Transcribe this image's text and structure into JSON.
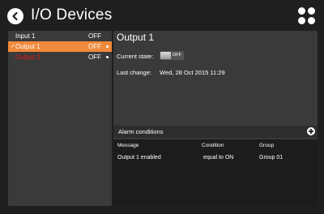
{
  "header": {
    "title": "I/O Devices"
  },
  "icons": {
    "back": "back-arrow-icon",
    "apps": "apps-grid-icon",
    "add": "plus-icon",
    "check": "checkmark-icon"
  },
  "colors": {
    "selected": "#f08a3c",
    "error": "#e01818",
    "panel": "#3a3a3a",
    "background": "#1f1f1f"
  },
  "list": {
    "items": [
      {
        "name": "Input 1",
        "state": "OFF",
        "selected": false,
        "checked": false,
        "error": false
      },
      {
        "name": "Output 1",
        "state": "OFF",
        "selected": true,
        "checked": true,
        "error": false
      },
      {
        "name": "Output 2",
        "state": "OFF",
        "selected": false,
        "checked": false,
        "error": true
      }
    ]
  },
  "detail": {
    "title": "Output 1",
    "current_state_label": "Current state:",
    "toggle_label": "OFF",
    "last_change_label": "Last change:",
    "last_change_value": "Wed, 28 Oct 2015 11:29"
  },
  "alarms": {
    "title": "Alarm conditions",
    "columns": [
      "Message",
      "Condition",
      "Group"
    ],
    "rows": [
      {
        "message": "Output 1 enabled",
        "condition": "equal to ON",
        "group": "Group 01"
      }
    ]
  }
}
